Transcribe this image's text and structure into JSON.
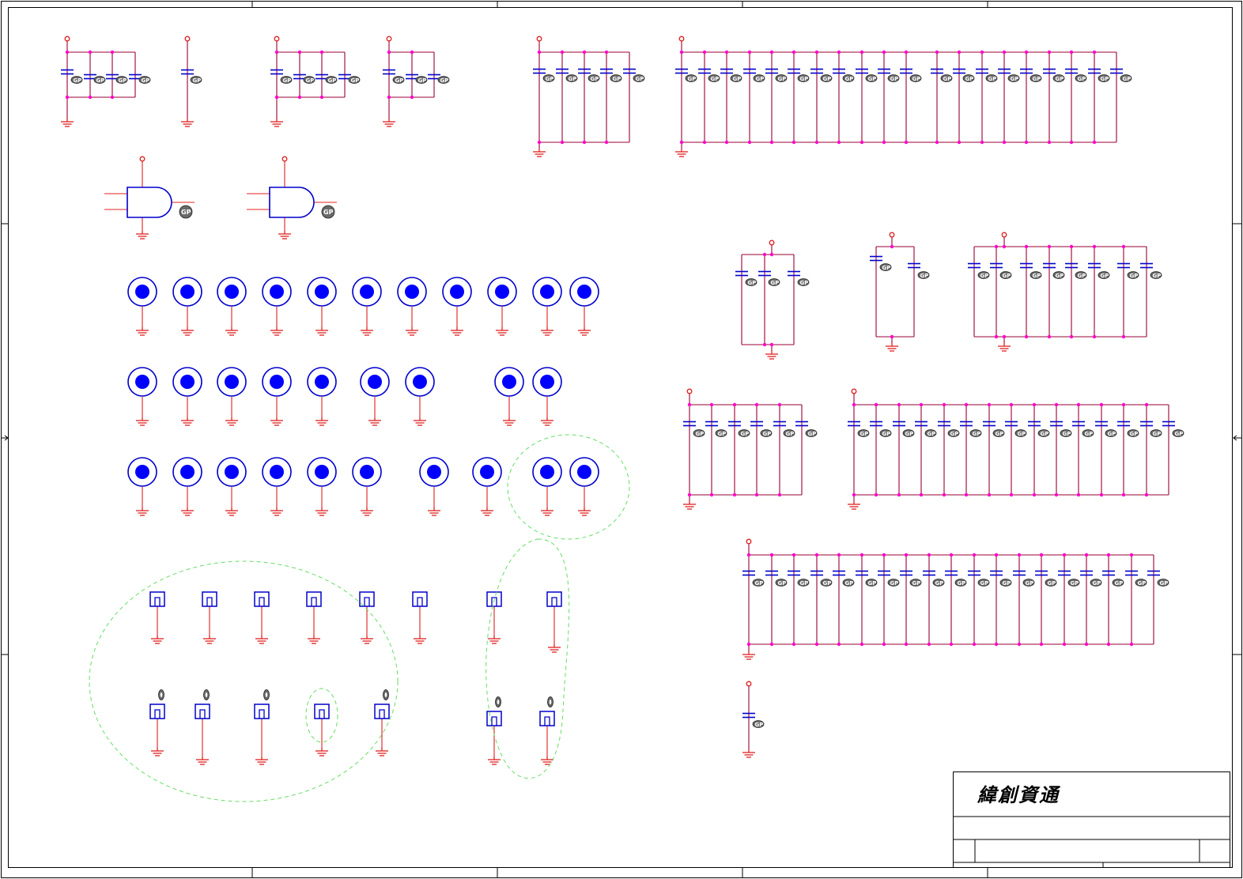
{
  "title_block": {
    "company": "緯創資通"
  },
  "colors": {
    "wire": "#990033",
    "power": "#e02020",
    "ground": "#e02020",
    "part": "#0000cc",
    "junction": "#ff00cc",
    "note_outline": "#66dd66",
    "frame": "#000000"
  },
  "icons": [
    "capacitor-icon",
    "ground-symbol-icon",
    "power-port-icon",
    "and-gate-icon",
    "mounting-hole-icon",
    "test-pad-icon",
    "do-not-install-marker-icon"
  ]
}
